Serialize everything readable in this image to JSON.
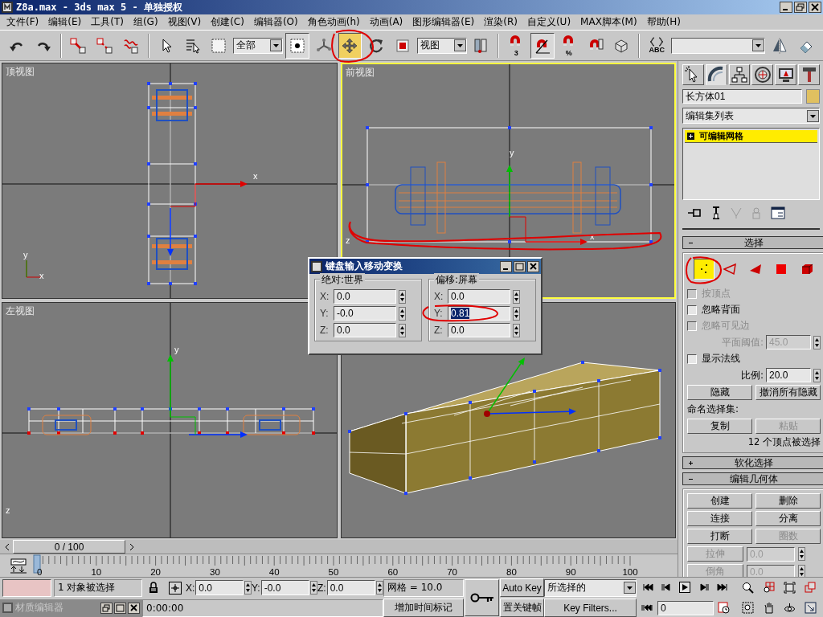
{
  "window": {
    "title": "Z8a.max - 3ds max 5 - 单独授权"
  },
  "menu": [
    "文件(F)",
    "编辑(E)",
    "工具(T)",
    "组(G)",
    "视图(V)",
    "创建(C)",
    "编辑器(O)",
    "角色动画(h)",
    "动画(A)",
    "图形编辑器(E)",
    "渲染(R)",
    "自定义(U)",
    "MAX脚本(M)",
    "帮助(H)"
  ],
  "toolbar": [
    {
      "kind": "undo",
      "selected": false
    },
    {
      "kind": "redo",
      "selected": false
    },
    {
      "kind": "separator"
    },
    {
      "kind": "link",
      "selected": false
    },
    {
      "kind": "unlink",
      "selected": false
    },
    {
      "kind": "bind",
      "selected": false
    },
    {
      "kind": "separator"
    },
    {
      "kind": "select",
      "selected": false
    },
    {
      "kind": "selectname",
      "selected": false
    },
    {
      "kind": "region",
      "selected": false
    },
    {
      "kind": "dropdown",
      "value": "全部"
    },
    {
      "kind": "window",
      "selected": true
    },
    {
      "kind": "manipulate",
      "selected": false
    },
    {
      "kind": "move",
      "selected": true
    },
    {
      "kind": "rotate",
      "selected": false
    },
    {
      "kind": "scale",
      "selected": false
    },
    {
      "kind": "dropdown",
      "value": "视图"
    },
    {
      "kind": "pivot",
      "selected": false
    },
    {
      "kind": "separator"
    },
    {
      "kind": "snap",
      "badge": "3",
      "selected": false
    },
    {
      "kind": "anglesnap",
      "selected": true
    },
    {
      "kind": "percentsnap",
      "badge": "%",
      "selected": false
    },
    {
      "kind": "spinnersnap",
      "selected": false
    },
    {
      "kind": "box",
      "selected": false
    },
    {
      "kind": "separator"
    },
    {
      "kind": "braces",
      "badge": "ABC",
      "selected": false
    },
    {
      "kind": "dropdown"
    },
    {
      "kind": "mirror",
      "selected": false
    },
    {
      "kind": "align",
      "selected": false
    }
  ],
  "viewports": [
    {
      "kind": "top",
      "label": "顶视图",
      "active": false,
      "gizmo_labels": [
        "x"
      ],
      "triad_labels": [
        "y",
        "x"
      ]
    },
    {
      "kind": "front",
      "label": "前视图",
      "active": true,
      "gizmo_labels": [
        "y",
        "x"
      ],
      "triad_labels": [
        "z"
      ]
    },
    {
      "kind": "left",
      "label": "左视图",
      "active": false,
      "gizmo_labels": [
        "y"
      ],
      "triad_labels": [
        "z"
      ]
    },
    {
      "kind": "perspective",
      "active": false
    }
  ],
  "dialog": {
    "title": "键盘输入移动变换",
    "groups": [
      {
        "label": "绝对:世界",
        "fields": [
          {
            "axis": "X:",
            "value": "0.0",
            "selected": false
          },
          {
            "axis": "Y:",
            "value": "-0.0",
            "selected": false
          },
          {
            "axis": "Z:",
            "value": "0.0",
            "selected": false
          }
        ]
      },
      {
        "label": "偏移:屏幕",
        "fields": [
          {
            "axis": "X:",
            "value": "0.0",
            "selected": false
          },
          {
            "axis": "Y:",
            "value": "0.81",
            "selected": true
          },
          {
            "axis": "Z:",
            "value": "0.0",
            "selected": false
          }
        ]
      }
    ]
  },
  "command_panel": {
    "tabs": [
      {
        "kind": "create",
        "selected": false
      },
      {
        "kind": "modify",
        "selected": true
      },
      {
        "kind": "hierarchy",
        "selected": false
      },
      {
        "kind": "motion",
        "selected": false
      },
      {
        "kind": "display",
        "selected": false
      },
      {
        "kind": "utilities",
        "selected": false
      }
    ],
    "object_name": "长方体01",
    "modifier_list": "编辑集列表",
    "stack": [
      {
        "label": "可编辑网格",
        "selected": true,
        "expanded": false
      }
    ],
    "rollouts": [
      {
        "title": "选择",
        "expanded": true,
        "subobjects": [
          {
            "kind": "vertex",
            "selected": true
          },
          {
            "kind": "edge",
            "selected": false
          },
          {
            "kind": "face",
            "selected": false
          },
          {
            "kind": "polygon",
            "selected": false
          },
          {
            "kind": "element",
            "selected": false
          }
        ],
        "rows": [
          {
            "kind": "checkbox",
            "label": "按顶点",
            "checked": false,
            "disabled": true
          },
          {
            "kind": "checkbox",
            "label": "忽略背面",
            "checked": false,
            "disabled": false
          },
          {
            "kind": "checkbox",
            "label": "忽略可见边",
            "checked": false,
            "disabled": true
          },
          {
            "kind": "spinner",
            "label": "平面阈值:",
            "value": "45.0",
            "disabled": true
          },
          {
            "kind": "checkbox",
            "label": "显示法线",
            "checked": false,
            "disabled": false
          },
          {
            "kind": "spinner",
            "label": "比例:",
            "value": "20.0",
            "disabled": false
          },
          {
            "kind": "buttons",
            "buttons": [
              {
                "label": "隐藏",
                "disabled": false
              },
              {
                "label": "撤消所有隐藏",
                "disabled": false
              }
            ]
          },
          {
            "kind": "text",
            "label": "命名选择集:"
          },
          {
            "kind": "buttons",
            "buttons": [
              {
                "label": "复制",
                "disabled": false
              },
              {
                "label": "粘贴",
                "disabled": true
              }
            ]
          },
          {
            "kind": "status",
            "label": "12 个顶点被选择"
          }
        ]
      },
      {
        "title": "软化选择",
        "expanded": false
      },
      {
        "title": "编辑几何体",
        "expanded": true,
        "rows": [
          {
            "kind": "buttons",
            "buttons": [
              {
                "label": "创建",
                "disabled": false
              },
              {
                "label": "删除",
                "disabled": false
              }
            ]
          },
          {
            "kind": "buttons",
            "buttons": [
              {
                "label": "连接",
                "disabled": false
              },
              {
                "label": "分离",
                "disabled": false
              }
            ]
          },
          {
            "kind": "buttons",
            "buttons": [
              {
                "label": "打断",
                "disabled": false
              },
              {
                "label": "圈数",
                "disabled": true
              }
            ]
          },
          {
            "kind": "buttonspinner",
            "label": "拉伸",
            "value": "0.0",
            "disabled": true
          },
          {
            "kind": "buttonspinner",
            "label": "倒角",
            "value": "0.0",
            "disabled": true
          }
        ]
      }
    ]
  },
  "time_slider": {
    "label": "0 / 100",
    "level": 0
  },
  "track_bar": {
    "ticks": [
      "0",
      "10",
      "20",
      "30",
      "40",
      "50",
      "60",
      "70",
      "80",
      "90",
      "100"
    ],
    "level": 0
  },
  "status": {
    "selection": "1 对象被选择",
    "coords": [
      {
        "label": "X:",
        "value": "0.0"
      },
      {
        "label": "Y:",
        "value": "-0.0"
      },
      {
        "label": "Z:",
        "value": "0.0"
      }
    ],
    "grid": "网格 = 10.0",
    "auto_key": "Auto Key",
    "key_mode": "所选择的",
    "minimized_window": "材质编辑器",
    "time": "0:00:00",
    "add_time_tag": "增加时间标记",
    "set_key": "置关键帧",
    "key_filters": "Key Filters...",
    "frame": "0"
  }
}
